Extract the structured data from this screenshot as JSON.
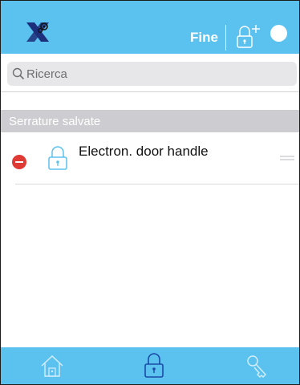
{
  "header": {
    "done_label": "Fine",
    "icons": {
      "logo": "app-logo-icon",
      "add_lock": "add-lock-icon",
      "status": "status-dot"
    }
  },
  "search": {
    "placeholder": "Ricerca",
    "value": ""
  },
  "saved_locks": {
    "section_title": "Serrature salvate",
    "items": [
      {
        "name": "Electron. door handle",
        "icon": "padlock-icon"
      }
    ]
  },
  "tabbar": {
    "tabs": [
      {
        "name": "home",
        "icon": "home-icon",
        "active": false
      },
      {
        "name": "locks",
        "icon": "padlock-icon",
        "active": true
      },
      {
        "name": "keys",
        "icon": "key-icon",
        "active": false
      }
    ]
  },
  "colors": {
    "accent": "#5bc2f0",
    "active_tab_icon": "#1a4aa8",
    "inactive_tab_icon": "#d6eefb",
    "delete": "#e03a35",
    "section_header": "#cdcdd1",
    "logo_dark": "#1d2f7a"
  }
}
